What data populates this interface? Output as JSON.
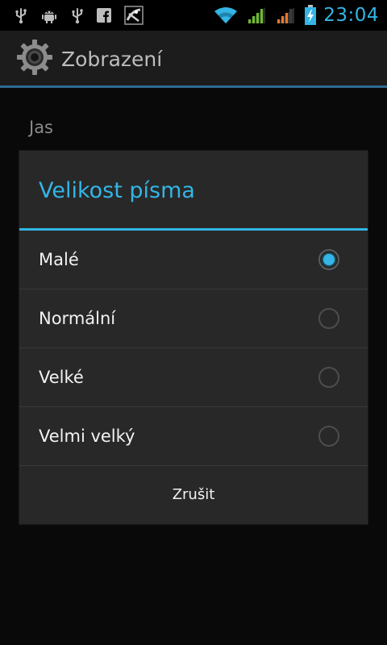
{
  "status_bar": {
    "clock": "23:04",
    "left_icons": [
      "usb-icon",
      "android-debug-icon",
      "usb-icon",
      "facebook-icon",
      "app-notification-icon"
    ],
    "right_icons": [
      "wifi-icon",
      "signal-icon",
      "signal-roaming-icon",
      "battery-charging-icon"
    ],
    "accent_color": "#33b5e5"
  },
  "action_bar": {
    "icon": "settings-gear-icon",
    "title": "Zobrazení"
  },
  "background": {
    "preference_label": "Jas"
  },
  "dialog": {
    "title": "Velikost písma",
    "options": [
      {
        "label": "Malé",
        "checked": true
      },
      {
        "label": "Normální",
        "checked": false
      },
      {
        "label": "Velké",
        "checked": false
      },
      {
        "label": "Velmi velký",
        "checked": false
      }
    ],
    "cancel_label": "Zrušit"
  }
}
